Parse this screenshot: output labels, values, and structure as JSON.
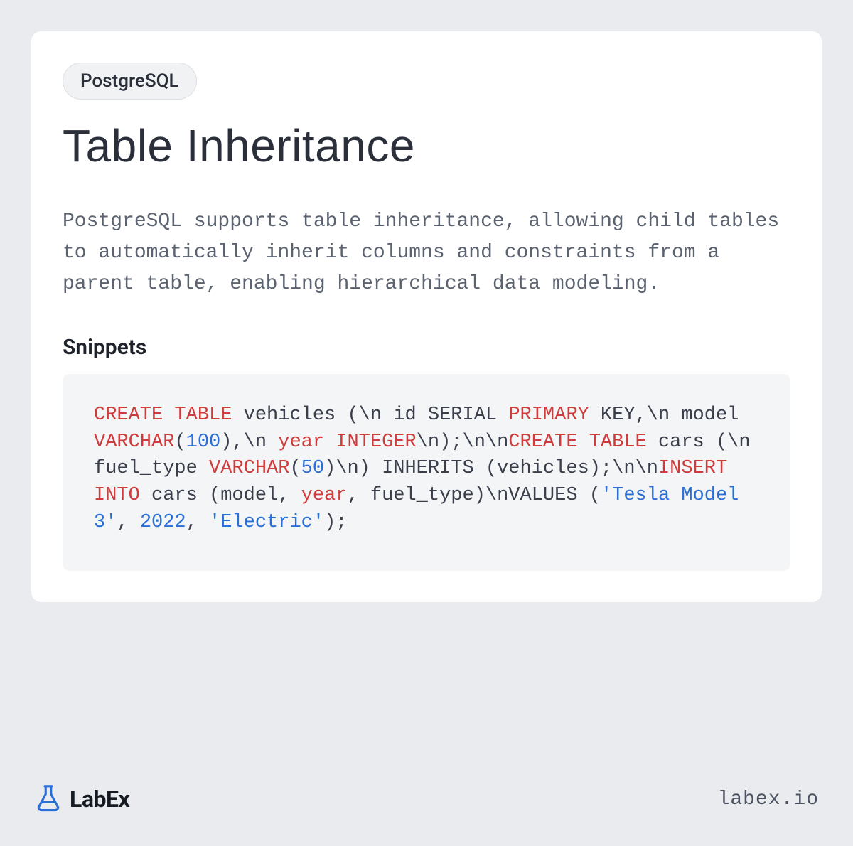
{
  "tag": "PostgreSQL",
  "title": "Table Inheritance",
  "description": "PostgreSQL supports table inheritance, allowing child tables to automatically inherit columns and constraints from a parent table, enabling hierarchical data modeling.",
  "snippets_heading": "Snippets",
  "code": {
    "tokens": [
      {
        "t": "CREATE",
        "c": "kw"
      },
      {
        "t": " "
      },
      {
        "t": "TABLE",
        "c": "kw"
      },
      {
        "t": " vehicles (\\n    id SERIAL "
      },
      {
        "t": "PRIMARY",
        "c": "kw"
      },
      {
        "t": " KEY,\\n    model "
      },
      {
        "t": "VARCHAR",
        "c": "kw"
      },
      {
        "t": "("
      },
      {
        "t": "100",
        "c": "num"
      },
      {
        "t": "),\\n    "
      },
      {
        "t": "year",
        "c": "kw"
      },
      {
        "t": " "
      },
      {
        "t": "INTEGER",
        "c": "kw"
      },
      {
        "t": "\\n);\\n\\n"
      },
      {
        "t": "CREATE",
        "c": "kw"
      },
      {
        "t": " "
      },
      {
        "t": "TABLE",
        "c": "kw"
      },
      {
        "t": " cars (\\n    fuel_type "
      },
      {
        "t": "VARCHAR",
        "c": "kw"
      },
      {
        "t": "("
      },
      {
        "t": "50",
        "c": "num"
      },
      {
        "t": ")\\n) INHERITS (vehicles);\\n\\n"
      },
      {
        "t": "INSERT",
        "c": "kw"
      },
      {
        "t": " "
      },
      {
        "t": "INTO",
        "c": "kw"
      },
      {
        "t": " cars (model, "
      },
      {
        "t": "year",
        "c": "kw"
      },
      {
        "t": ", fuel_type)\\nVALUES ("
      },
      {
        "t": "'Tesla Model 3'",
        "c": "str"
      },
      {
        "t": ", "
      },
      {
        "t": "2022",
        "c": "num"
      },
      {
        "t": ", "
      },
      {
        "t": "'Electric'",
        "c": "str"
      },
      {
        "t": ");"
      }
    ]
  },
  "brand": "LabEx",
  "site": "labex.io"
}
